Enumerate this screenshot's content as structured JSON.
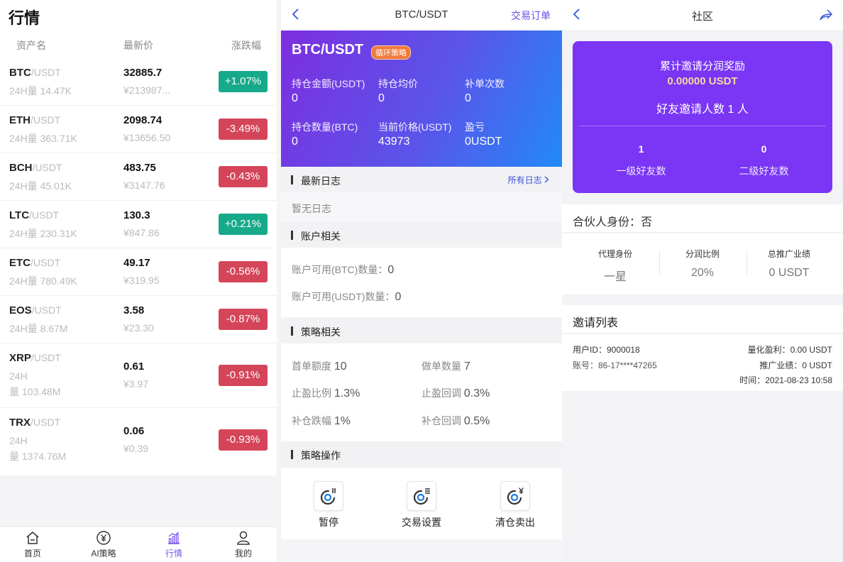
{
  "market": {
    "title": "行情",
    "headers": {
      "asset": "资产名",
      "price": "最新价",
      "change": "涨跌幅"
    },
    "rows": [
      {
        "base": "BTC",
        "quote": "/USDT",
        "vol1": "24H量 14.47K",
        "vol2": "",
        "price": "32885.7",
        "cny": "¥213987...",
        "change": "+1.07%",
        "dir": "up"
      },
      {
        "base": "ETH",
        "quote": "/USDT",
        "vol1": "24H量 363.71K",
        "vol2": "",
        "price": "2098.74",
        "cny": "¥13656.50",
        "change": "-3.49%",
        "dir": "down"
      },
      {
        "base": "BCH",
        "quote": "/USDT",
        "vol1": "24H量 45.01K",
        "vol2": "",
        "price": "483.75",
        "cny": "¥3147.76",
        "change": "-0.43%",
        "dir": "down"
      },
      {
        "base": "LTC",
        "quote": "/USDT",
        "vol1": "24H量 230.31K",
        "vol2": "",
        "price": "130.3",
        "cny": "¥847.86",
        "change": "+0.21%",
        "dir": "up"
      },
      {
        "base": "ETC",
        "quote": "/USDT",
        "vol1": "24H量 780.49K",
        "vol2": "",
        "price": "49.17",
        "cny": "¥319.95",
        "change": "-0.56%",
        "dir": "down"
      },
      {
        "base": "EOS",
        "quote": "/USDT",
        "vol1": "24H量 8.67M",
        "vol2": "",
        "price": "3.58",
        "cny": "¥23.30",
        "change": "-0.87%",
        "dir": "down"
      },
      {
        "base": "XRP",
        "quote": "/USDT",
        "vol1": "24H",
        "vol2": "量 103.48M",
        "price": "0.61",
        "cny": "¥3.97",
        "change": "-0.91%",
        "dir": "down"
      },
      {
        "base": "TRX",
        "quote": "/USDT",
        "vol1": "24H",
        "vol2": "量 1374.76M",
        "price": "0.06",
        "cny": "¥0.39",
        "change": "-0.93%",
        "dir": "down"
      }
    ],
    "tabs": [
      {
        "label": "首页",
        "icon": "home-icon"
      },
      {
        "label": "AI策略",
        "icon": "yuan-coin-icon"
      },
      {
        "label": "行情",
        "icon": "market-chart-icon"
      },
      {
        "label": "我的",
        "icon": "profile-icon"
      }
    ],
    "colors": {
      "up": "#16a98a",
      "down": "#d5455a",
      "active_tab": "#7a55f0"
    }
  },
  "detail": {
    "nav": {
      "title": "BTC/USDT",
      "right": "交易订单"
    },
    "hero": {
      "pair": "BTC/USDT",
      "tag": "循环策略",
      "stats": [
        {
          "label": "持仓金额(USDT)",
          "value": "0"
        },
        {
          "label": "持仓均价",
          "value": "0"
        },
        {
          "label": "补单次数",
          "value": "0"
        },
        {
          "label": "持仓数量(BTC)",
          "value": "0"
        },
        {
          "label": "当前价格(USDT)",
          "value": "43973"
        },
        {
          "label": "盈亏",
          "value": "0USDT"
        }
      ]
    },
    "log": {
      "title": "最新日志",
      "more": "所有日志",
      "empty": "暂无日志"
    },
    "account": {
      "title": "账户相关",
      "btc_label": "账户可用(BTC)数量：",
      "btc_value": "0",
      "usdt_label": "账户可用(USDT)数量：",
      "usdt_value": "0"
    },
    "strategy": {
      "title": "策略相关",
      "items": [
        {
          "label": "首单额度",
          "value": "10"
        },
        {
          "label": "做单数量",
          "value": "7"
        },
        {
          "label": "止盈比例",
          "value": "1.3%"
        },
        {
          "label": "止盈回调",
          "value": "0.3%"
        },
        {
          "label": "补仓跌幅",
          "value": "1%"
        },
        {
          "label": "补仓回调",
          "value": "0.5%"
        }
      ]
    },
    "ops": {
      "title": "策略操作",
      "items": [
        {
          "label": "暂停",
          "icon": "pause-icon"
        },
        {
          "label": "交易设置",
          "icon": "settings-icon"
        },
        {
          "label": "清仓卖出",
          "icon": "sell-all-icon"
        }
      ]
    }
  },
  "community": {
    "nav": {
      "title": "社区"
    },
    "card": {
      "title": "累计邀请分润奖励",
      "amount": "0.00000 USDT",
      "invites": "好友邀请人数 1 人",
      "level1_count": "1",
      "level1_label": "一级好友数",
      "level2_count": "0",
      "level2_label": "二级好友数"
    },
    "partner": "合伙人身份：否",
    "stats": [
      {
        "label": "代理身份",
        "value": "一星"
      },
      {
        "label": "分润比例",
        "value": "20%"
      },
      {
        "label": "总推广业绩",
        "value": "0 USDT"
      }
    ],
    "invite_list": {
      "title": "邀请列表",
      "entry": {
        "user_id": "用户ID：9000018",
        "account": "账号：86-17****47265",
        "profit": "量化盈利：0.00 USDT",
        "perf": "推广业绩：0 USDT",
        "time": "时间：2021-08-23 10:58"
      }
    }
  }
}
